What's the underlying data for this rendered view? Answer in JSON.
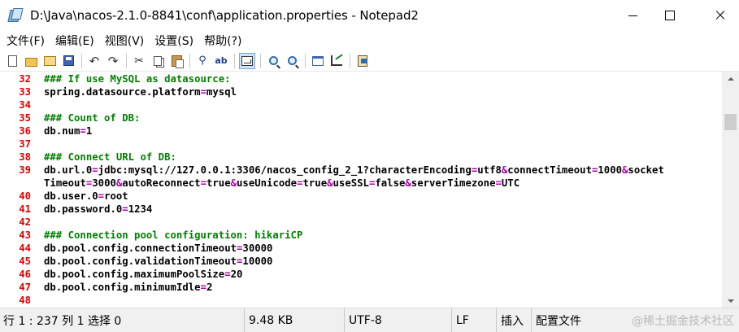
{
  "window": {
    "title": "D:\\Java\\nacos-2.1.0-8841\\conf\\application.properties - Notepad2",
    "app_icon": "notepad2-icon"
  },
  "menu": [
    {
      "label": "文件(F)"
    },
    {
      "label": "编辑(E)"
    },
    {
      "label": "视图(V)"
    },
    {
      "label": "设置(S)"
    },
    {
      "label": "帮助(?)"
    }
  ],
  "toolbar": {
    "groups": [
      [
        "new-icon",
        "open-icon",
        "browse-icon",
        "save-icon"
      ],
      [
        "undo-icon",
        "redo-icon"
      ],
      [
        "cut-icon",
        "copy-icon",
        "paste-icon"
      ],
      [
        "find-icon",
        "replace-icon"
      ],
      [
        "word-wrap-icon"
      ],
      [
        "zoom-in-icon",
        "zoom-out-icon"
      ],
      [
        "scheme-icon",
        "customize-icon"
      ],
      [
        "exit-icon"
      ]
    ],
    "active": "word-wrap-icon"
  },
  "editor": {
    "lines": [
      {
        "num": "32",
        "text": "### If use MySQL as datasource:",
        "type": "comment"
      },
      {
        "num": "33",
        "text": "spring.datasource.platform=mysql",
        "type": "text"
      },
      {
        "num": "34",
        "text": "",
        "type": "text"
      },
      {
        "num": "35",
        "text": "### Count of DB:",
        "type": "comment"
      },
      {
        "num": "36",
        "text": "db.num=1",
        "type": "text"
      },
      {
        "num": "37",
        "text": "",
        "type": "text"
      },
      {
        "num": "38",
        "text": "### Connect URL of DB:",
        "type": "comment"
      },
      {
        "num": "39",
        "text": "db.url.0=jdbc:mysql://127.0.0.1:3306/nacos_config_2_1?characterEncoding=utf8&connectTimeout=1000&socket",
        "type": "text"
      },
      {
        "num": "",
        "text": "Timeout=3000&autoReconnect=true&useUnicode=true&useSSL=false&serverTimezone=UTC",
        "type": "text"
      },
      {
        "num": "40",
        "text": "db.user.0=root",
        "type": "text"
      },
      {
        "num": "41",
        "text": "db.password.0=1234",
        "type": "text"
      },
      {
        "num": "42",
        "text": "",
        "type": "text"
      },
      {
        "num": "43",
        "text": "### Connection pool configuration: hikariCP",
        "type": "comment"
      },
      {
        "num": "44",
        "text": "db.pool.config.connectionTimeout=30000",
        "type": "text"
      },
      {
        "num": "45",
        "text": "db.pool.config.validationTimeout=10000",
        "type": "text"
      },
      {
        "num": "46",
        "text": "db.pool.config.maximumPoolSize=20",
        "type": "text"
      },
      {
        "num": "47",
        "text": "db.pool.config.minimumIdle=2",
        "type": "text"
      },
      {
        "num": "48",
        "text": "",
        "type": "text"
      }
    ]
  },
  "status": {
    "position": "行 1 : 237   列 1   选择 0",
    "size": "9.48 KB",
    "encoding": "UTF-8",
    "eol": "LF",
    "mode": "插入",
    "scheme": "配置文件",
    "watermark": "@稀土掘金技术社区"
  }
}
